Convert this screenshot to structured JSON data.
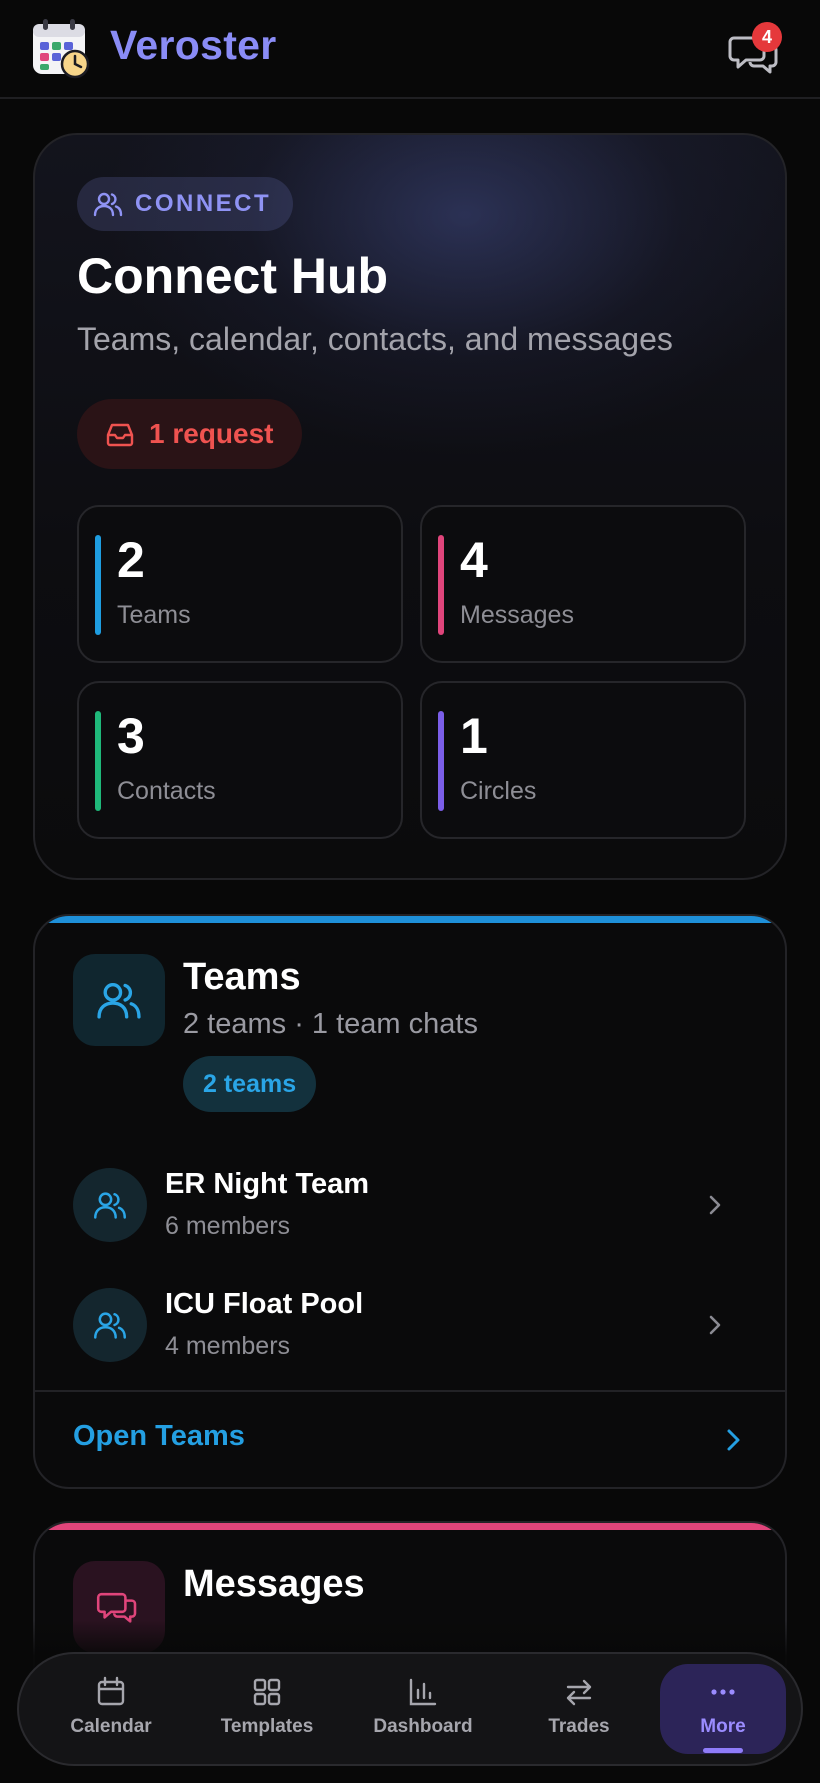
{
  "app": {
    "name": "Veroster"
  },
  "header": {
    "notification_count": "4"
  },
  "hub": {
    "chip": "CONNECT",
    "title": "Connect Hub",
    "subtitle": "Teams, calendar, contacts, and messages",
    "request": "1 request",
    "stats": [
      {
        "value": "2",
        "label": "Teams",
        "color": "#1e9de0"
      },
      {
        "value": "4",
        "label": "Messages",
        "color": "#e0457b"
      },
      {
        "value": "3",
        "label": "Contacts",
        "color": "#1fb97a"
      },
      {
        "value": "1",
        "label": "Circles",
        "color": "#7b5ee8"
      }
    ]
  },
  "teams": {
    "title": "Teams",
    "subtitle": "2 teams · 1 team chats",
    "badge": "2 teams",
    "items": [
      {
        "name": "ER Night Team",
        "members": "6 members"
      },
      {
        "name": "ICU Float Pool",
        "members": "4 members"
      }
    ],
    "open_label": "Open Teams",
    "accent": "#1e90d9"
  },
  "messages_card": {
    "title": "Messages",
    "accent": "#e0457b"
  },
  "nav": {
    "items": [
      {
        "label": "Calendar",
        "icon": "calendar-icon"
      },
      {
        "label": "Templates",
        "icon": "grid-icon"
      },
      {
        "label": "Dashboard",
        "icon": "bar-chart-icon"
      },
      {
        "label": "Trades",
        "icon": "swap-icon"
      },
      {
        "label": "More",
        "icon": "more-icon",
        "active": true
      }
    ]
  }
}
